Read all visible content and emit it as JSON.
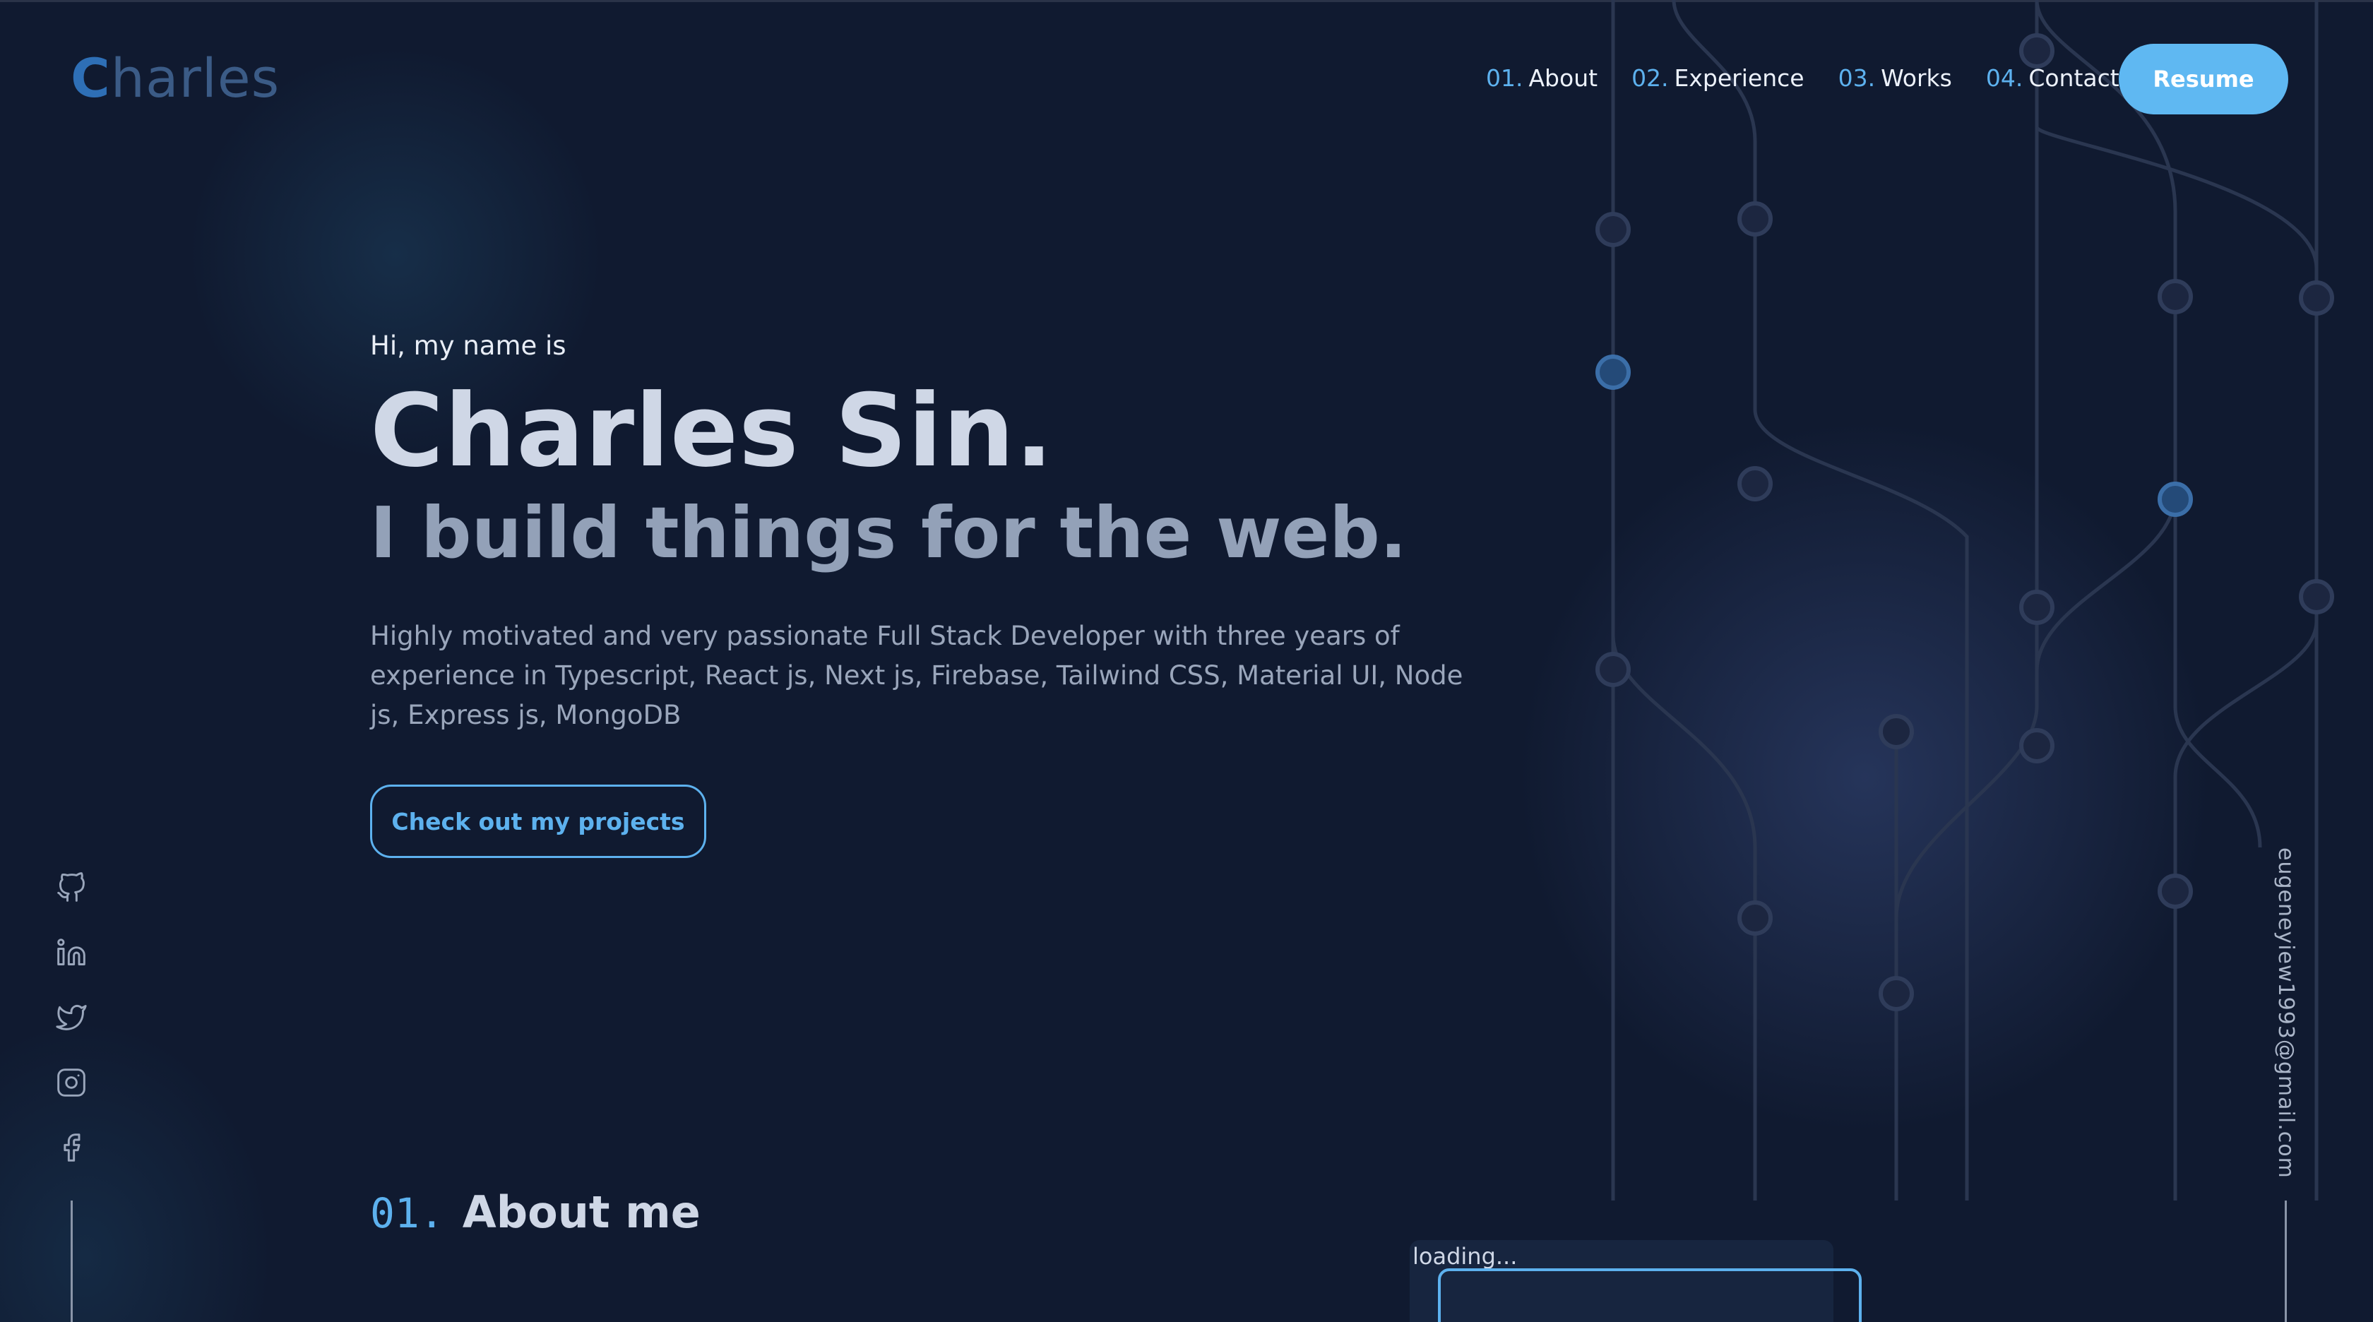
{
  "brand": {
    "logo_first": "C",
    "logo_rest": "harles"
  },
  "nav": {
    "items": [
      {
        "num": "01.",
        "label": "About"
      },
      {
        "num": "02.",
        "label": "Experience"
      },
      {
        "num": "03.",
        "label": "Works"
      },
      {
        "num": "04.",
        "label": "Contact"
      }
    ],
    "resume_label": "Resume"
  },
  "hero": {
    "greeting": "Hi, my name is",
    "name": "Charles Sin.",
    "tagline": "I build things for the web.",
    "bio": "Highly motivated and very passionate Full Stack Developer with three years of experience in Typescript, React js, Next js, Firebase, Tailwind CSS, Material UI, Node js, Express js, MongoDB",
    "cta_label": "Check out my projects"
  },
  "socials": [
    "github-icon",
    "linkedin-icon",
    "twitter-icon",
    "instagram-icon",
    "facebook-icon"
  ],
  "email": "eugeneyiew1993@gmail.com",
  "about": {
    "num": "01.",
    "title": "About me",
    "image_alt": "loading..."
  },
  "colors": {
    "background": "#101a30",
    "accent": "#5db1ee",
    "button": "#5fb8f2",
    "heading": "#cfd7e6",
    "muted": "#9aa6bb"
  }
}
